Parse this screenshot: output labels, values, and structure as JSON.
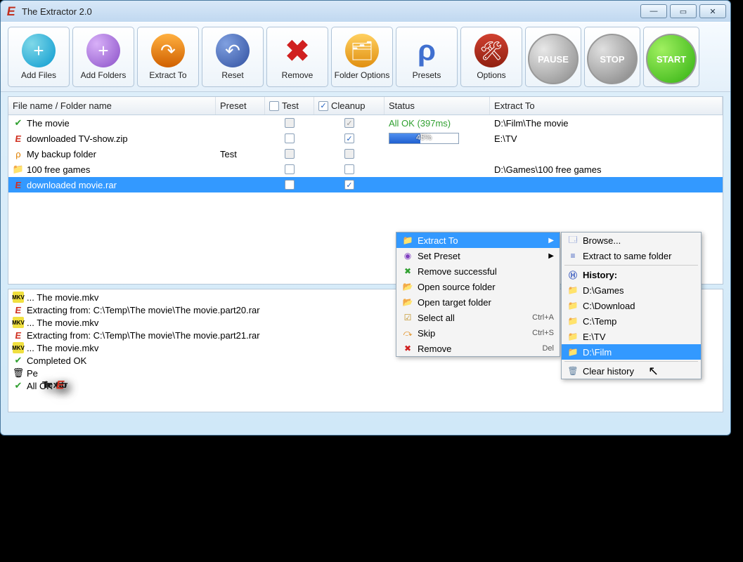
{
  "window": {
    "title": "The Extractor 2.0"
  },
  "toolbar": {
    "add_files": "Add Files",
    "add_folders": "Add Folders",
    "extract_to": "Extract To",
    "reset": "Reset",
    "remove": "Remove",
    "folder_options": "Folder Options",
    "presets": "Presets",
    "options": "Options",
    "pause": "PAUSE",
    "stop": "STOP",
    "start": "START"
  },
  "columns": {
    "name": "File name / Folder name",
    "preset": "Preset",
    "test": "Test",
    "cleanup": "Cleanup",
    "status": "Status",
    "extract_to": "Extract To"
  },
  "header_test_checked": false,
  "header_cleanup_checked": true,
  "rows": [
    {
      "icon": "ok",
      "name": "The movie",
      "preset": "",
      "test": "disabled",
      "cleanup": "disabled-checked",
      "status_type": "ok",
      "status": "All OK (397ms)",
      "extract_to": "D:\\Film\\The movie"
    },
    {
      "icon": "red",
      "name": "downloaded TV-show.zip",
      "preset": "",
      "test": "unchecked",
      "cleanup": "checked",
      "status_type": "progress",
      "progress": 45,
      "extract_to": "E:\\TV"
    },
    {
      "icon": "preset",
      "name": "My backup folder",
      "preset": "Test",
      "test": "disabled",
      "cleanup": "disabled",
      "status_type": "none",
      "extract_to": ""
    },
    {
      "icon": "folder",
      "name": "100 free games",
      "preset": "",
      "test": "unchecked",
      "cleanup": "unchecked",
      "status_type": "none",
      "extract_to": "D:\\Games\\100 free games"
    },
    {
      "icon": "red",
      "name": "downloaded movie.rar",
      "preset": "",
      "test": "unchecked",
      "cleanup": "checked",
      "status_type": "none",
      "extract_to": "",
      "selected": true
    }
  ],
  "log": [
    {
      "icon": "mkv",
      "text": "... The movie.mkv"
    },
    {
      "icon": "red",
      "text": "Extracting from: C:\\Temp\\The movie\\The movie.part20.rar"
    },
    {
      "icon": "mkv",
      "text": "... The movie.mkv"
    },
    {
      "icon": "red",
      "text": "Extracting from: C:\\Temp\\The movie\\The movie.part21.rar"
    },
    {
      "icon": "mkv",
      "text": "... The movie.mkv"
    },
    {
      "icon": "ok",
      "text": "Completed OK"
    },
    {
      "icon": "trash",
      "text": "Pe"
    },
    {
      "icon": "ok",
      "text": "All OK"
    }
  ],
  "context_menu": {
    "extract_to": "Extract To",
    "set_preset": "Set Preset",
    "remove_successful": "Remove successful",
    "open_source": "Open source folder",
    "open_target": "Open target folder",
    "select_all": "Select all",
    "select_all_key": "Ctrl+A",
    "skip": "Skip",
    "skip_key": "Ctrl+S",
    "remove": "Remove",
    "remove_key": "Del"
  },
  "submenu": {
    "browse": "Browse...",
    "same_folder": "Extract to same folder",
    "history_header": "History:",
    "history": [
      "D:\\Games",
      "C:\\Download",
      "C:\\Temp",
      "E:\\TV",
      "D:\\Film"
    ],
    "clear": "Clear history",
    "highlighted_index": 4
  },
  "logo": {
    "pre": "The",
    "post": "xtractor"
  }
}
